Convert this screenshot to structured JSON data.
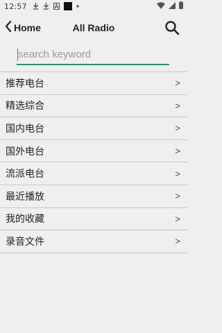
{
  "status_bar": {
    "time": "12:57",
    "icons": [
      "download-icon",
      "download-icon",
      "app-notification-icon",
      "black-square-icon",
      "dot-icon",
      "wifi-icon",
      "signal-icon",
      "battery-icon"
    ]
  },
  "toolbar": {
    "back_label": "Home",
    "title": "All Radio",
    "search_icon": "search-icon"
  },
  "search": {
    "placeholder": "search keyword",
    "value": ""
  },
  "menu": {
    "items": [
      {
        "label": "推荐电台",
        "arrow": ">"
      },
      {
        "label": "精选综合",
        "arrow": ">"
      },
      {
        "label": "国内电台",
        "arrow": ">"
      },
      {
        "label": "国外电台",
        "arrow": ">"
      },
      {
        "label": "流派电台",
        "arrow": ">"
      },
      {
        "label": "最近播放",
        "arrow": ">"
      },
      {
        "label": "我的收藏",
        "arrow": ">"
      },
      {
        "label": "录音文件",
        "arrow": ">"
      }
    ]
  },
  "colors": {
    "background": "#efefef",
    "accent": "#2e8b7a",
    "divider": "#c9c9c9"
  }
}
